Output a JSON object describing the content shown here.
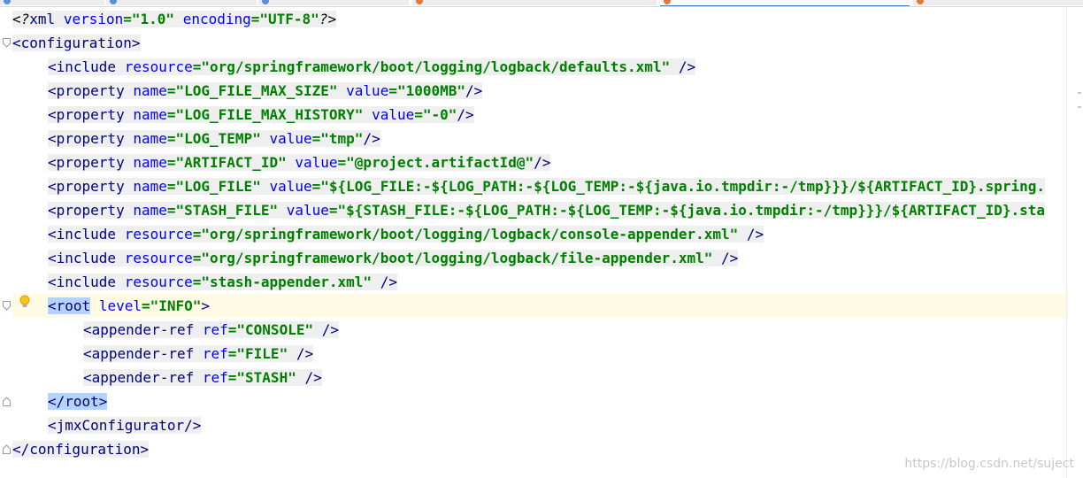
{
  "editor": {
    "lines": [
      {
        "id": "l01",
        "indent": 0,
        "parts": [
          [
            "p",
            "<"
          ],
          [
            "pi",
            "?"
          ],
          [
            "t",
            "xml "
          ],
          [
            "a",
            "version"
          ],
          [
            "v",
            "=\"1.0\""
          ],
          [
            "p",
            " "
          ],
          [
            "a",
            "encoding"
          ],
          [
            "v",
            "=\"UTF-8\""
          ],
          [
            "pi",
            "?"
          ],
          [
            "p",
            ">"
          ]
        ]
      },
      {
        "id": "l02",
        "indent": 0,
        "parts": [
          [
            "tagopen",
            "<configuration>"
          ]
        ]
      },
      {
        "id": "l03",
        "indent": 1,
        "parts": [
          [
            "t",
            "<include "
          ],
          [
            "a",
            "resource"
          ],
          [
            "v",
            "=\"org/springframework/boot/logging/logback/defaults.xml\""
          ],
          [
            "t",
            " />"
          ]
        ]
      },
      {
        "id": "l04",
        "indent": 1,
        "parts": [
          [
            "t",
            "<property "
          ],
          [
            "a",
            "name"
          ],
          [
            "v",
            "=\"LOG_FILE_MAX_SIZE\""
          ],
          [
            "p",
            " "
          ],
          [
            "a",
            "value"
          ],
          [
            "v",
            "=\"1000MB\""
          ],
          [
            "t",
            "/>"
          ]
        ]
      },
      {
        "id": "l05",
        "indent": 1,
        "parts": [
          [
            "t",
            "<property "
          ],
          [
            "a",
            "name"
          ],
          [
            "v",
            "=\"LOG_FILE_MAX_HISTORY\""
          ],
          [
            "p",
            " "
          ],
          [
            "a",
            "value"
          ],
          [
            "v",
            "=\"-0\""
          ],
          [
            "t",
            "/>"
          ]
        ]
      },
      {
        "id": "l06",
        "indent": 1,
        "parts": [
          [
            "t",
            "<property "
          ],
          [
            "a",
            "name"
          ],
          [
            "v",
            "=\"LOG_TEMP\""
          ],
          [
            "p",
            " "
          ],
          [
            "a",
            "value"
          ],
          [
            "v",
            "=\"tmp\""
          ],
          [
            "t",
            "/>"
          ]
        ]
      },
      {
        "id": "l07",
        "indent": 1,
        "parts": [
          [
            "t",
            "<property "
          ],
          [
            "a",
            "name"
          ],
          [
            "v",
            "=\"ARTIFACT_ID\""
          ],
          [
            "p",
            " "
          ],
          [
            "a",
            "value"
          ],
          [
            "v",
            "=\"@project.artifactId@\""
          ],
          [
            "t",
            "/>"
          ]
        ]
      },
      {
        "id": "l08",
        "indent": 1,
        "parts": [
          [
            "t",
            "<property "
          ],
          [
            "a",
            "name"
          ],
          [
            "v",
            "=\"LOG_FILE\""
          ],
          [
            "p",
            " "
          ],
          [
            "a",
            "value"
          ],
          [
            "v",
            "=\"${LOG_FILE:-${LOG_PATH:-${LOG_TEMP:-${java.io.tmpdir:-/tmp}}}/${ARTIFACT_ID}.spring."
          ]
        ]
      },
      {
        "id": "l09",
        "indent": 1,
        "parts": [
          [
            "t",
            "<property "
          ],
          [
            "a",
            "name"
          ],
          [
            "v",
            "=\"STASH_FILE\""
          ],
          [
            "p",
            " "
          ],
          [
            "a",
            "value"
          ],
          [
            "v",
            "=\"${STASH_FILE:-${LOG_PATH:-${LOG_TEMP:-${java.io.tmpdir:-/tmp}}}/${ARTIFACT_ID}.sta"
          ]
        ]
      },
      {
        "id": "l10",
        "indent": 1,
        "parts": [
          [
            "t",
            "<include "
          ],
          [
            "a",
            "resource"
          ],
          [
            "v",
            "=\"org/springframework/boot/logging/logback/console-appender.xml\""
          ],
          [
            "t",
            " />"
          ]
        ]
      },
      {
        "id": "l11",
        "indent": 1,
        "parts": [
          [
            "t",
            "<include "
          ],
          [
            "a",
            "resource"
          ],
          [
            "v",
            "=\"org/springframework/boot/logging/logback/file-appender.xml\""
          ],
          [
            "t",
            " />"
          ]
        ]
      },
      {
        "id": "l12",
        "indent": 1,
        "parts": [
          [
            "t",
            "<include "
          ],
          [
            "a",
            "resource"
          ],
          [
            "v",
            "=\"stash-appender.xml\""
          ],
          [
            "t",
            " />"
          ]
        ]
      },
      {
        "id": "l13",
        "indent": 1,
        "caret": true,
        "parts": [
          [
            "tm",
            "<root"
          ],
          [
            "p",
            " "
          ],
          [
            "a",
            "level"
          ],
          [
            "v",
            "=\"INFO\""
          ],
          [
            "t",
            ">"
          ]
        ]
      },
      {
        "id": "l14",
        "indent": 2,
        "parts": [
          [
            "t",
            "<appender-ref "
          ],
          [
            "a",
            "ref"
          ],
          [
            "v",
            "=\"CONSOLE\""
          ],
          [
            "t",
            " />"
          ]
        ]
      },
      {
        "id": "l15",
        "indent": 2,
        "parts": [
          [
            "t",
            "<appender-ref "
          ],
          [
            "a",
            "ref"
          ],
          [
            "v",
            "=\"FILE\""
          ],
          [
            "t",
            " />"
          ]
        ]
      },
      {
        "id": "l16",
        "indent": 2,
        "parts": [
          [
            "t",
            "<appender-ref "
          ],
          [
            "a",
            "ref"
          ],
          [
            "v",
            "=\"STASH\""
          ],
          [
            "t",
            " />"
          ]
        ]
      },
      {
        "id": "l17",
        "indent": 1,
        "parts": [
          [
            "tm",
            "</root>"
          ]
        ]
      },
      {
        "id": "l18",
        "indent": 1,
        "parts": [
          [
            "t",
            "<jmxConfigurator/>"
          ]
        ]
      },
      {
        "id": "l19",
        "indent": 0,
        "parts": [
          [
            "tagopen",
            "</configuration>"
          ]
        ]
      }
    ]
  },
  "gutter": {
    "bulb_icon": "lightbulb-icon",
    "fold_icon": "fold-marker-icon"
  },
  "watermark": "https://blog.csdn.net/suject",
  "colors": {
    "tag": "#000080",
    "attribute": "#0000ff",
    "value": "#008000",
    "tag_match_highlight": "#b4d3ff",
    "caret_row": "#fffae3",
    "line_background": "#efefef"
  }
}
